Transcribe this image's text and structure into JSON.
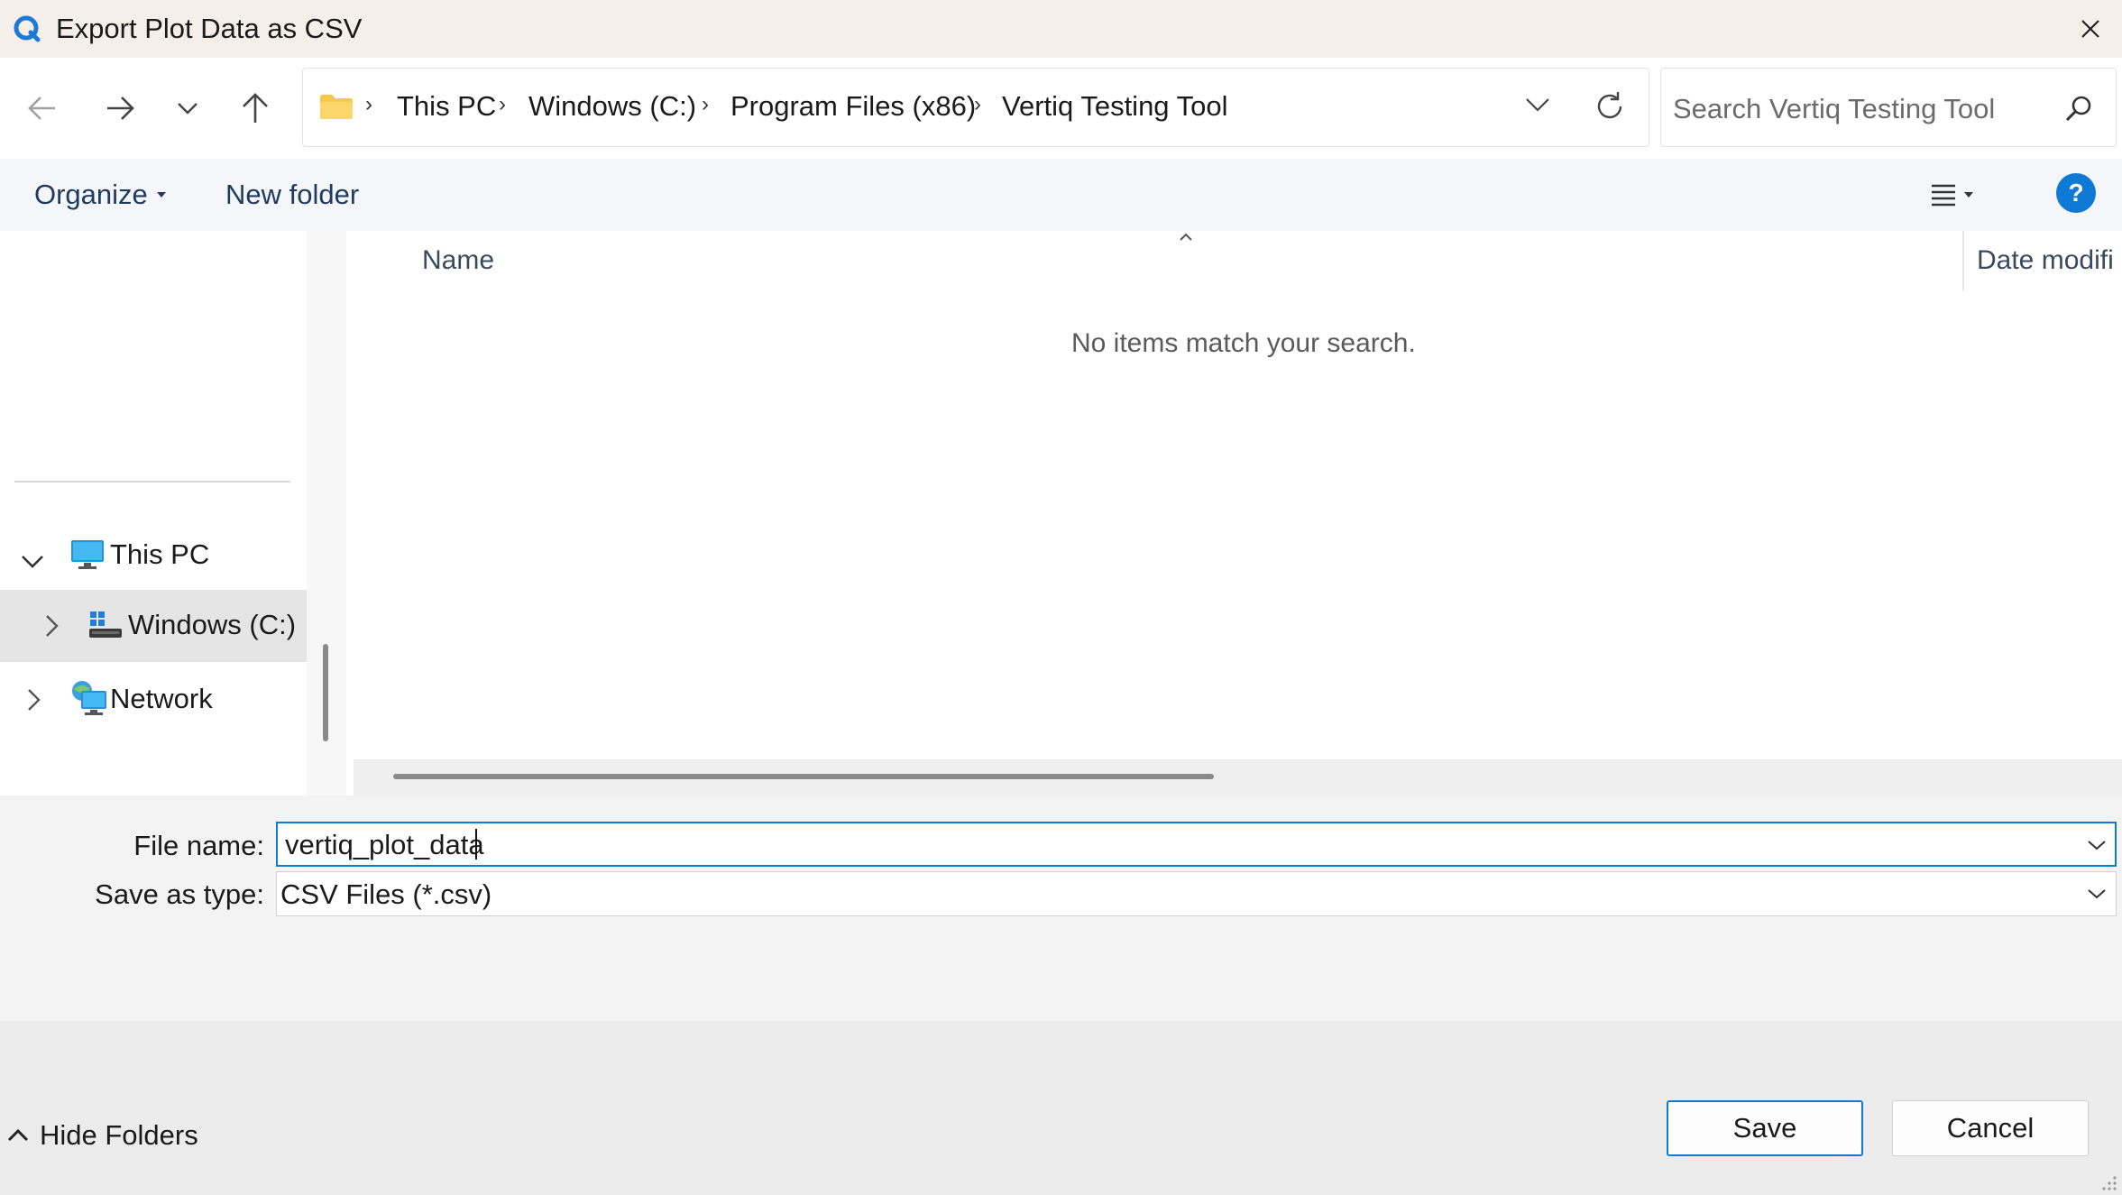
{
  "window": {
    "title": "Export Plot Data as CSV",
    "app_icon": "q-logo-icon",
    "close_icon": "close-icon"
  },
  "nav": {
    "back_icon": "arrow-left-icon",
    "forward_icon": "arrow-right-icon",
    "recent_icon": "chevron-down-icon",
    "up_icon": "arrow-up-icon",
    "breadcrumb": [
      "This PC",
      "Windows (C:)",
      "Program Files (x86)",
      "Vertiq Testing Tool"
    ],
    "refresh_icon": "refresh-icon",
    "search_placeholder": "Search Vertiq Testing Tool"
  },
  "toolbar": {
    "organize_label": "Organize",
    "new_folder_label": "New folder",
    "view_icon": "list-view-icon",
    "help_label": "?"
  },
  "sidebar": {
    "items": [
      {
        "label": "This PC",
        "icon": "monitor-icon",
        "expanded": true
      },
      {
        "label": "Windows (C:)",
        "icon": "drive-icon",
        "selected": true
      },
      {
        "label": "Network",
        "icon": "network-icon",
        "expanded": false
      }
    ]
  },
  "filelist": {
    "columns": [
      "Name",
      "Date modifi"
    ],
    "empty_message": "No items match your search."
  },
  "form": {
    "filename_label": "File name:",
    "filename_value": "vertiq_plot_data",
    "savetype_label": "Save as type:",
    "savetype_value": "CSV Files (*.csv)"
  },
  "footer": {
    "hide_folders_label": "Hide Folders",
    "save_label": "Save",
    "cancel_label": "Cancel"
  },
  "colors": {
    "accent": "#0f7ad6",
    "titlebar": "#f6eee8"
  }
}
